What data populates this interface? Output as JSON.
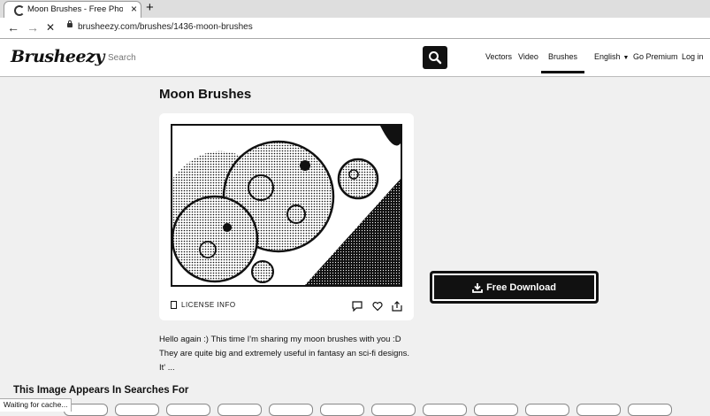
{
  "browser": {
    "tab_title": "Moon Brushes - Free Photosho",
    "tab_close": "×",
    "new_tab": "+",
    "back": "←",
    "forward": "→",
    "stop": "✕",
    "url": "brusheezy.com/brushes/1436-moon-brushes",
    "status_text": "Waiting for cache..."
  },
  "header": {
    "logo": "Brusheezy",
    "search_placeholder": "Search",
    "nav": {
      "vectors": "Vectors",
      "video": "Video",
      "brushes": "Brushes",
      "english": "English",
      "go_premium": "Go Premium",
      "login": "Log in"
    }
  },
  "main": {
    "title": "Moon Brushes",
    "license_label": "LICENSE INFO",
    "download_label": "Free Download",
    "description": "Hello again :) This time I'm sharing my moon brushes with you :D They are quite big and extremely useful in fantasy an sci-fi designs. It' ...",
    "searches_title": "This Image Appears In Searches For"
  },
  "icons": {
    "spinner": "loading-spinner-icon",
    "search": "search-icon",
    "comment": "comment-icon",
    "heart": "heart-icon",
    "share": "share-icon",
    "download": "download-icon",
    "license": "document-icon",
    "lock": "lock-icon"
  },
  "colors": {
    "accent": "#111111",
    "background": "#f0f0f0",
    "card": "#ffffff"
  }
}
